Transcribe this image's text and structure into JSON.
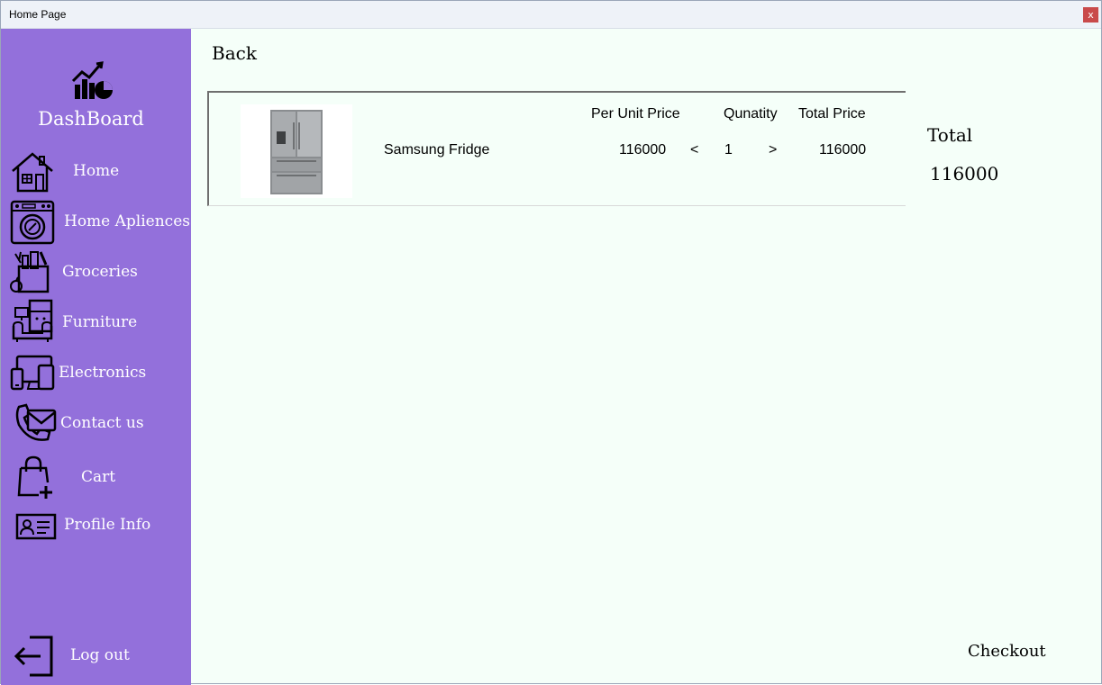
{
  "window": {
    "title": "Home Page",
    "close_label": "x"
  },
  "sidebar": {
    "title": "DashBoard",
    "items": [
      {
        "label": "Home",
        "icon": "house-icon"
      },
      {
        "label": "Home Apliences",
        "icon": "washing-machine-icon"
      },
      {
        "label": "Groceries",
        "icon": "grocery-bag-icon"
      },
      {
        "label": "Furniture",
        "icon": "sofa-icon"
      },
      {
        "label": "Electronics",
        "icon": "devices-icon"
      },
      {
        "label": "Contact us",
        "icon": "phone-mail-icon"
      },
      {
        "label": "Cart",
        "icon": "shopping-bag-icon"
      },
      {
        "label": "Profile Info",
        "icon": "id-card-icon"
      }
    ],
    "logout_label": "Log out"
  },
  "main": {
    "back_label": "Back",
    "columns": {
      "unit_price": "Per Unit Price",
      "quantity": "Qunatity",
      "total_price": "Total Price"
    },
    "cart_items": [
      {
        "name": "Samsung Fridge",
        "unit_price": "116000",
        "decrement": "<",
        "quantity": "1",
        "increment": ">",
        "total_price": "116000"
      }
    ],
    "total_label": "Total",
    "total_value": "116000",
    "checkout_label": "Checkout"
  },
  "colors": {
    "sidebar": "#9370db",
    "content_bg": "#f5fff9",
    "close_button": "#c94a4a"
  }
}
